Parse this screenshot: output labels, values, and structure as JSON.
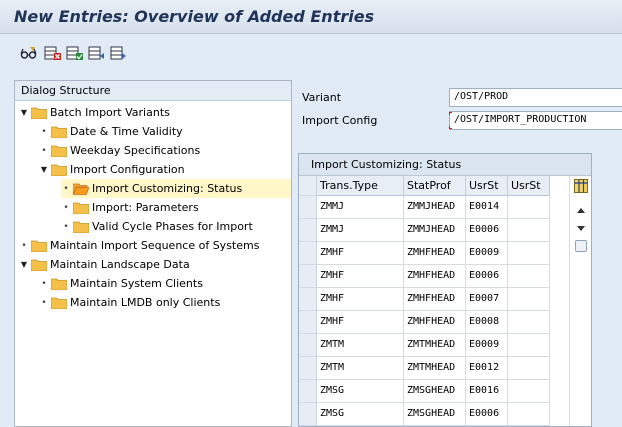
{
  "window": {
    "title": "New Entries: Overview of Added Entries"
  },
  "toolbar": {
    "buttons": [
      {
        "icon": "glasses-display-icon"
      },
      {
        "icon": "table-delete-icon"
      },
      {
        "icon": "table-save-icon"
      },
      {
        "icon": "table-prev-icon"
      },
      {
        "icon": "table-next-icon"
      }
    ]
  },
  "dialog_structure": {
    "header": "Dialog Structure",
    "items": [
      {
        "label": "Batch Import Variants",
        "level": 0,
        "expanded": true
      },
      {
        "label": "Date & Time Validity",
        "level": 1
      },
      {
        "label": "Weekday Specifications",
        "level": 1
      },
      {
        "label": "Import Configuration",
        "level": 1,
        "expanded": true
      },
      {
        "label": "Import Customizing: Status",
        "level": 2,
        "selected": true
      },
      {
        "label": "Import: Parameters",
        "level": 2
      },
      {
        "label": "Valid Cycle Phases for Import",
        "level": 2
      },
      {
        "label": "Maintain Import Sequence of Systems",
        "level": 0
      },
      {
        "label": "Maintain Landscape Data",
        "level": 0,
        "expanded": true
      },
      {
        "label": "Maintain System Clients",
        "level": 1
      },
      {
        "label": "Maintain LMDB only Clients",
        "level": 1
      }
    ]
  },
  "fields": {
    "variant": {
      "label": "Variant",
      "value": "/OST/PROD"
    },
    "import_config": {
      "label": "Import Config",
      "value": "/OST/IMPORT_PRODUCTION"
    }
  },
  "table": {
    "title": "Import Customizing: Status",
    "columns": [
      "Trans.Type",
      "StatProf",
      "UsrSt",
      "UsrSt"
    ],
    "rows": [
      [
        "ZMMJ",
        "ZMMJHEAD",
        "E0014",
        ""
      ],
      [
        "ZMMJ",
        "ZMMJHEAD",
        "E0006",
        ""
      ],
      [
        "ZMHF",
        "ZMHFHEAD",
        "E0009",
        ""
      ],
      [
        "ZMHF",
        "ZMHFHEAD",
        "E0006",
        ""
      ],
      [
        "ZMHF",
        "ZMHFHEAD",
        "E0007",
        ""
      ],
      [
        "ZMHF",
        "ZMHFHEAD",
        "E0008",
        ""
      ],
      [
        "ZMTM",
        "ZMTMHEAD",
        "E0009",
        ""
      ],
      [
        "ZMTM",
        "ZMTMHEAD",
        "E0012",
        ""
      ],
      [
        "ZMSG",
        "ZMSGHEAD",
        "E0016",
        ""
      ],
      [
        "ZMSG",
        "ZMSGHEAD",
        "E0006",
        ""
      ]
    ]
  },
  "colors": {
    "folder": "#f4c04a",
    "folder_selected": "#f79a1d",
    "title_text": "#1f3457"
  }
}
